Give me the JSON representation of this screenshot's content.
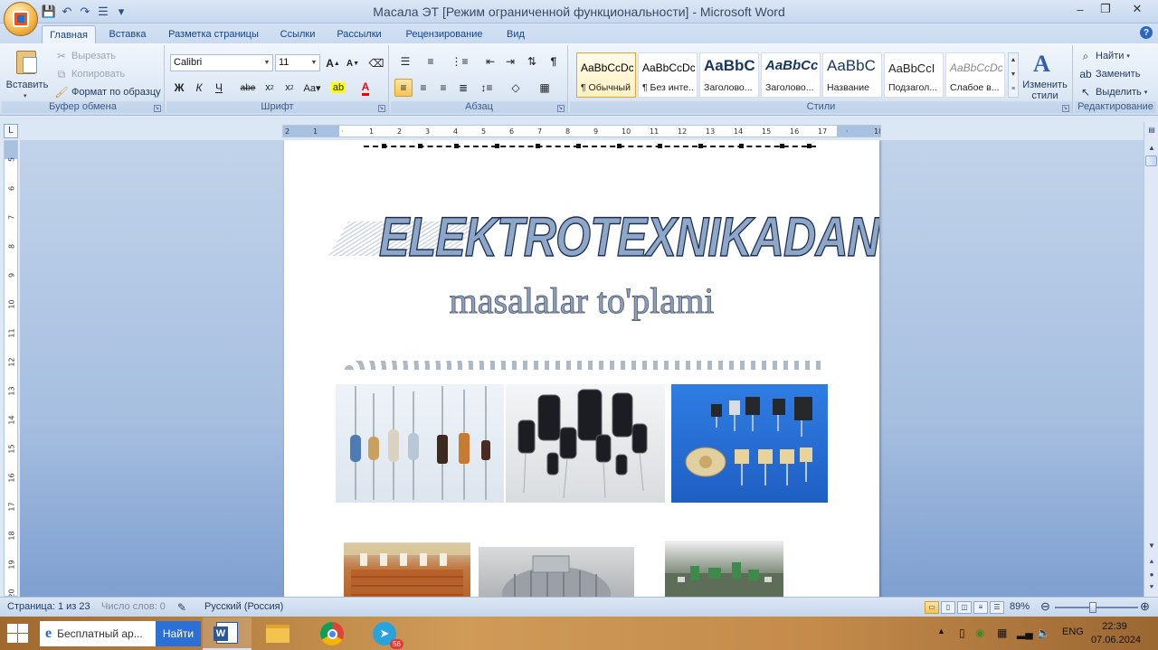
{
  "window": {
    "title": "Масала ЭТ [Режим ограниченной функциональности] - Microsoft Word",
    "controls": {
      "minimize": "–",
      "restore": "❐",
      "close": "✕"
    }
  },
  "tabs": [
    "Главная",
    "Вставка",
    "Разметка страницы",
    "Ссылки",
    "Рассылки",
    "Рецензирование",
    "Вид"
  ],
  "ribbon": {
    "clipboard": {
      "label": "Буфер обмена",
      "paste": "Вставить",
      "cut": "Вырезать",
      "copy": "Копировать",
      "format_painter": "Формат по образцу"
    },
    "font": {
      "label": "Шрифт",
      "font_name": "Calibri",
      "font_size": "11"
    },
    "paragraph": {
      "label": "Абзац"
    },
    "styles": {
      "label": "Стили",
      "items": [
        {
          "sample": "AaBbCcDc",
          "name": "¶ Обычный"
        },
        {
          "sample": "AaBbCcDc",
          "name": "¶ Без инте..."
        },
        {
          "sample": "AaBbC",
          "name": "Заголово..."
        },
        {
          "sample": "AaBbCc",
          "name": "Заголово..."
        },
        {
          "sample": "AaBbC",
          "name": "Название"
        },
        {
          "sample": "AaBbCcI",
          "name": "Подзагол..."
        },
        {
          "sample": "AaBbCcDc",
          "name": "Слабое в..."
        }
      ],
      "change_styles": "Изменить стили"
    },
    "editing": {
      "label": "Редактирование",
      "find": "Найти",
      "replace": "Заменить",
      "select": "Выделить"
    }
  },
  "document": {
    "headline": "ELEKTROTEXNIKADAN",
    "subtitle": "masalalar to'plami"
  },
  "statusbar": {
    "page": "Страница: 1 из 23",
    "words": "Число слов: 0",
    "language": "Русский (Россия)",
    "zoom": "89%"
  },
  "taskbar": {
    "search_text": "Бесплатный ар...",
    "search_button": "Найти",
    "telegram_badge": "56",
    "language": "ENG",
    "time": "22:39",
    "date": "07.06.2024"
  },
  "colors": {
    "accent": "#2c6fd6",
    "headline_fill": "#8fa7c7",
    "ribbon_text": "#15428b"
  }
}
